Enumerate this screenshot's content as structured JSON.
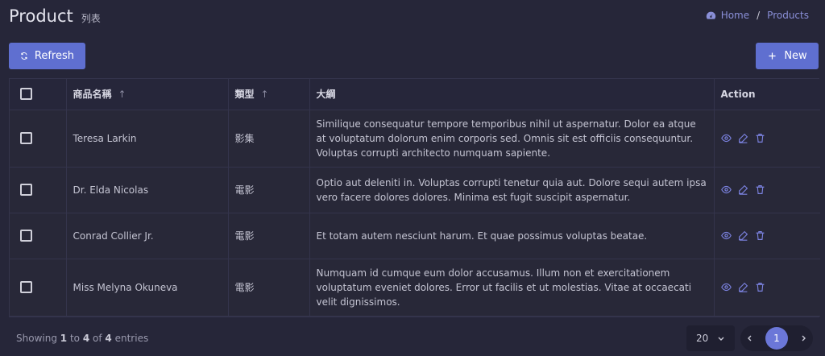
{
  "header": {
    "title": "Product",
    "subtitle": "列表"
  },
  "breadcrumb": {
    "home": "Home",
    "separator": "/",
    "current": "Products"
  },
  "toolbar": {
    "refresh_label": "Refresh",
    "new_label": "New"
  },
  "table": {
    "columns": {
      "name": "商品名稱",
      "type": "類型",
      "summary": "大綱",
      "action": "Action"
    },
    "sort_indicator": "↑",
    "rows": [
      {
        "name": "Teresa Larkin",
        "type": "影集",
        "summary": "Similique consequatur tempore temporibus nihil ut aspernatur. Dolor ea atque at voluptatum dolorum enim corporis sed. Omnis sit est officiis consequuntur. Voluptas corrupti architecto numquam sapiente."
      },
      {
        "name": "Dr. Elda Nicolas",
        "type": "電影",
        "summary": "Optio aut deleniti in. Voluptas corrupti tenetur quia aut. Dolore sequi autem ipsa vero facere dolores dolores. Minima est fugit suscipit aspernatur."
      },
      {
        "name": "Conrad Collier Jr.",
        "type": "電影",
        "summary": "Et totam autem nesciunt harum. Et quae possimus voluptas beatae."
      },
      {
        "name": "Miss Melyna Okuneva",
        "type": "電影",
        "summary": "Numquam id cumque eum dolor accusamus. Illum non et exercitationem voluptatum eveniet dolores. Error ut facilis et ut molestias. Vitae at occaecati velit dignissimos."
      }
    ]
  },
  "footer": {
    "showing": "Showing",
    "from": "1",
    "to_word": "to",
    "to": "4",
    "of_word": "of",
    "total": "4",
    "entries": "entries",
    "page_size": "20",
    "current_page": "1"
  },
  "colors": {
    "accent": "#5f6fd0",
    "background": "#262639",
    "link": "#8a8fd8"
  },
  "icons": [
    "dashboard-icon",
    "refresh-icon",
    "plus-icon",
    "eye-icon",
    "edit-icon",
    "trash-icon",
    "chevron-down-icon",
    "chevron-left-icon",
    "chevron-right-icon"
  ]
}
